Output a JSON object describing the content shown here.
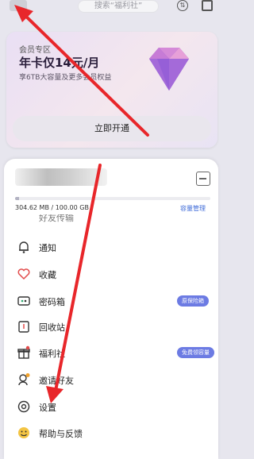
{
  "topbar": {
    "search_placeholder": "搜索“福利社”",
    "sync_icon": "sync-icon",
    "scan_icon": "scan-icon"
  },
  "vip": {
    "zone": "会员专区",
    "title": "年卡仅14元/月",
    "subtitle": "享6TB大容量及更多会员权益",
    "open_button": "立即开通"
  },
  "storage": {
    "usage_text": "304.62 MB / 100.00 GB",
    "used_fraction": 0.003,
    "manage_link": "容量管理"
  },
  "menu": {
    "partial_label": "好友传输",
    "items": [
      {
        "label": "通知",
        "icon": "bell-icon"
      },
      {
        "label": "收藏",
        "icon": "heart-icon"
      },
      {
        "label": "密码箱",
        "icon": "safe-icon",
        "badge": "原保险箱"
      },
      {
        "label": "回收站",
        "icon": "trash-icon"
      },
      {
        "label": "福利社",
        "icon": "gift-icon",
        "badge": "免费领容量"
      },
      {
        "label": "邀请好友",
        "icon": "invite-icon"
      },
      {
        "label": "设置",
        "icon": "settings-icon"
      },
      {
        "label": "帮助与反馈",
        "icon": "help-icon"
      }
    ]
  },
  "colors": {
    "accent_blue": "#3f6bd8",
    "badge_purple": "#6c7be3",
    "annotation_red": "#e8262a"
  }
}
